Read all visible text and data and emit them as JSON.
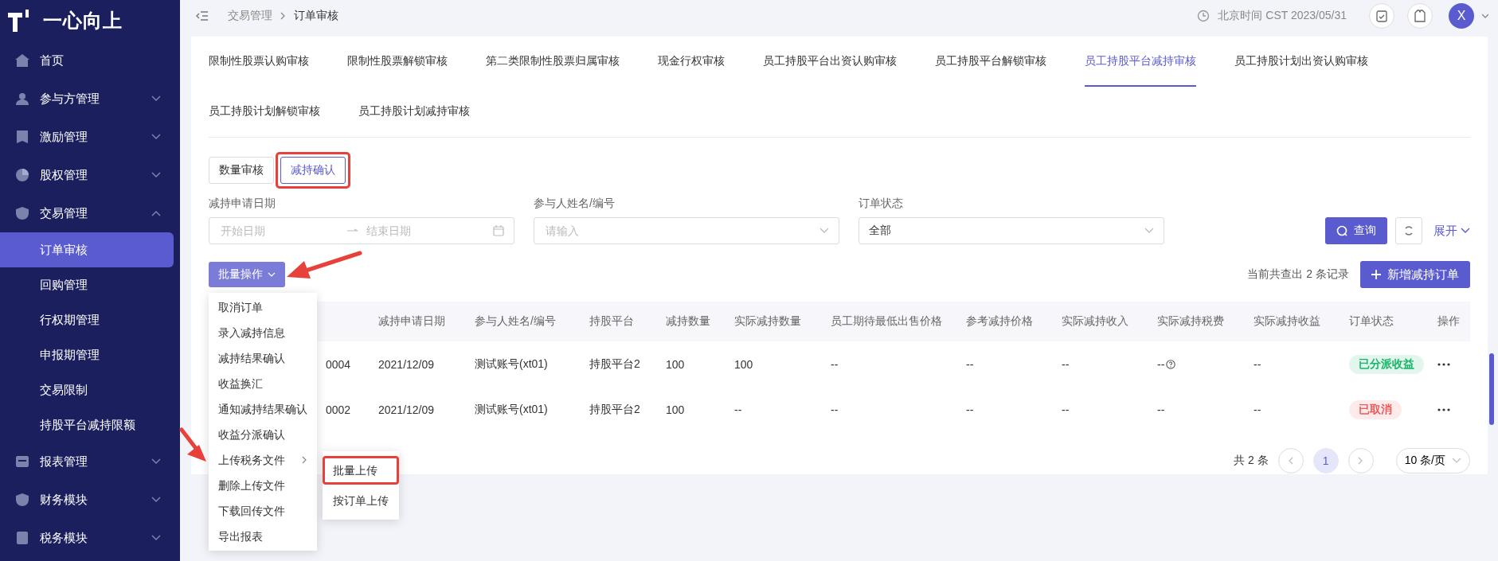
{
  "brand": {
    "name": "一心向上"
  },
  "sidebar": {
    "items": [
      {
        "label": "首页"
      },
      {
        "label": "参与方管理",
        "expanded": false
      },
      {
        "label": "激励管理",
        "expanded": false
      },
      {
        "label": "股权管理",
        "expanded": false
      },
      {
        "label": "交易管理",
        "expanded": true,
        "children": [
          {
            "label": "订单审核",
            "selected": true
          },
          {
            "label": "回购管理",
            "selected": false
          },
          {
            "label": "行权期管理",
            "selected": false
          },
          {
            "label": "申报期管理",
            "selected": false
          },
          {
            "label": "交易限制",
            "selected": false
          },
          {
            "label": "持股平台减持限额",
            "selected": false
          }
        ]
      },
      {
        "label": "报表管理",
        "expanded": false
      },
      {
        "label": "财务模块",
        "expanded": false
      },
      {
        "label": "税务模块",
        "expanded": false
      }
    ]
  },
  "topbar": {
    "breadcrumb": [
      "交易管理",
      "订单审核"
    ],
    "clock": "北京时间 CST 2023/05/31",
    "avatar": "X"
  },
  "tabs": [
    {
      "label": "限制性股票认购审核",
      "selected": false
    },
    {
      "label": "限制性股票解锁审核",
      "selected": false
    },
    {
      "label": "第二类限制性股票归属审核",
      "selected": false
    },
    {
      "label": "现金行权审核",
      "selected": false
    },
    {
      "label": "员工持股平台出资认购审核",
      "selected": false
    },
    {
      "label": "员工持股平台解锁审核",
      "selected": false
    },
    {
      "label": "员工持股平台减持审核",
      "selected": true
    },
    {
      "label": "员工持股计划出资认购审核",
      "selected": false
    },
    {
      "label": "员工持股计划解锁审核",
      "selected": false
    },
    {
      "label": "员工持股计划减持审核",
      "selected": false
    }
  ],
  "subtabs": [
    {
      "label": "数量审核",
      "selected": false,
      "highlighted": false
    },
    {
      "label": "减持确认",
      "selected": true,
      "highlighted": true
    }
  ],
  "filters": {
    "date": {
      "label": "减持申请日期",
      "start_placeholder": "开始日期",
      "end_placeholder": "结束日期"
    },
    "person": {
      "label": "参与人姓名/编号",
      "placeholder": "请输入"
    },
    "status": {
      "label": "订单状态",
      "value": "全部"
    },
    "search_button": "查询",
    "expand_link": "展开"
  },
  "toolbar": {
    "batch_button": "批量操作",
    "record_count": "当前共查出 2 条记录",
    "add_button": "新增减持订单"
  },
  "batch_menu": {
    "items": [
      {
        "label": "取消订单"
      },
      {
        "label": "录入减持信息"
      },
      {
        "label": "减持结果确认"
      },
      {
        "label": "收益换汇"
      },
      {
        "label": "通知减持结果确认"
      },
      {
        "label": "收益分派确认"
      },
      {
        "label": "上传税务文件",
        "submenu": [
          {
            "label": "批量上传",
            "highlighted": true
          },
          {
            "label": "按订单上传",
            "highlighted": false
          }
        ]
      },
      {
        "label": "删除上传文件"
      },
      {
        "label": "下载回传文件"
      },
      {
        "label": "导出报表"
      }
    ]
  },
  "table": {
    "columns": [
      "",
      "减持申请日期",
      "参与人姓名/编号",
      "持股平台",
      "减持数量",
      "实际减持数量",
      "员工期待最低出售价格",
      "参考减持价格",
      "实际减持收入",
      "实际减持税费",
      "实际减持收益",
      "订单状态",
      "操作"
    ],
    "rows": [
      {
        "cells": [
          "0004",
          "2021/12/09",
          "测试账号(xt01)",
          "持股平台2",
          "100",
          "100",
          "--",
          "--",
          "--",
          "--",
          "--"
        ],
        "tax_hint": true,
        "status": {
          "label": "已分派收益",
          "color": "#19b56a"
        }
      },
      {
        "cells": [
          "0002",
          "2021/12/09",
          "测试账号(xt01)",
          "持股平台2",
          "100",
          "--",
          "--",
          "--",
          "--",
          "--",
          "--"
        ],
        "tax_hint": false,
        "status": {
          "label": "已取消",
          "color": "#ee5a5a"
        }
      }
    ]
  },
  "pagination": {
    "total": "共 2 条",
    "pages": [
      {
        "label": "1",
        "selected": true
      }
    ],
    "page_size": "10 条/页"
  }
}
